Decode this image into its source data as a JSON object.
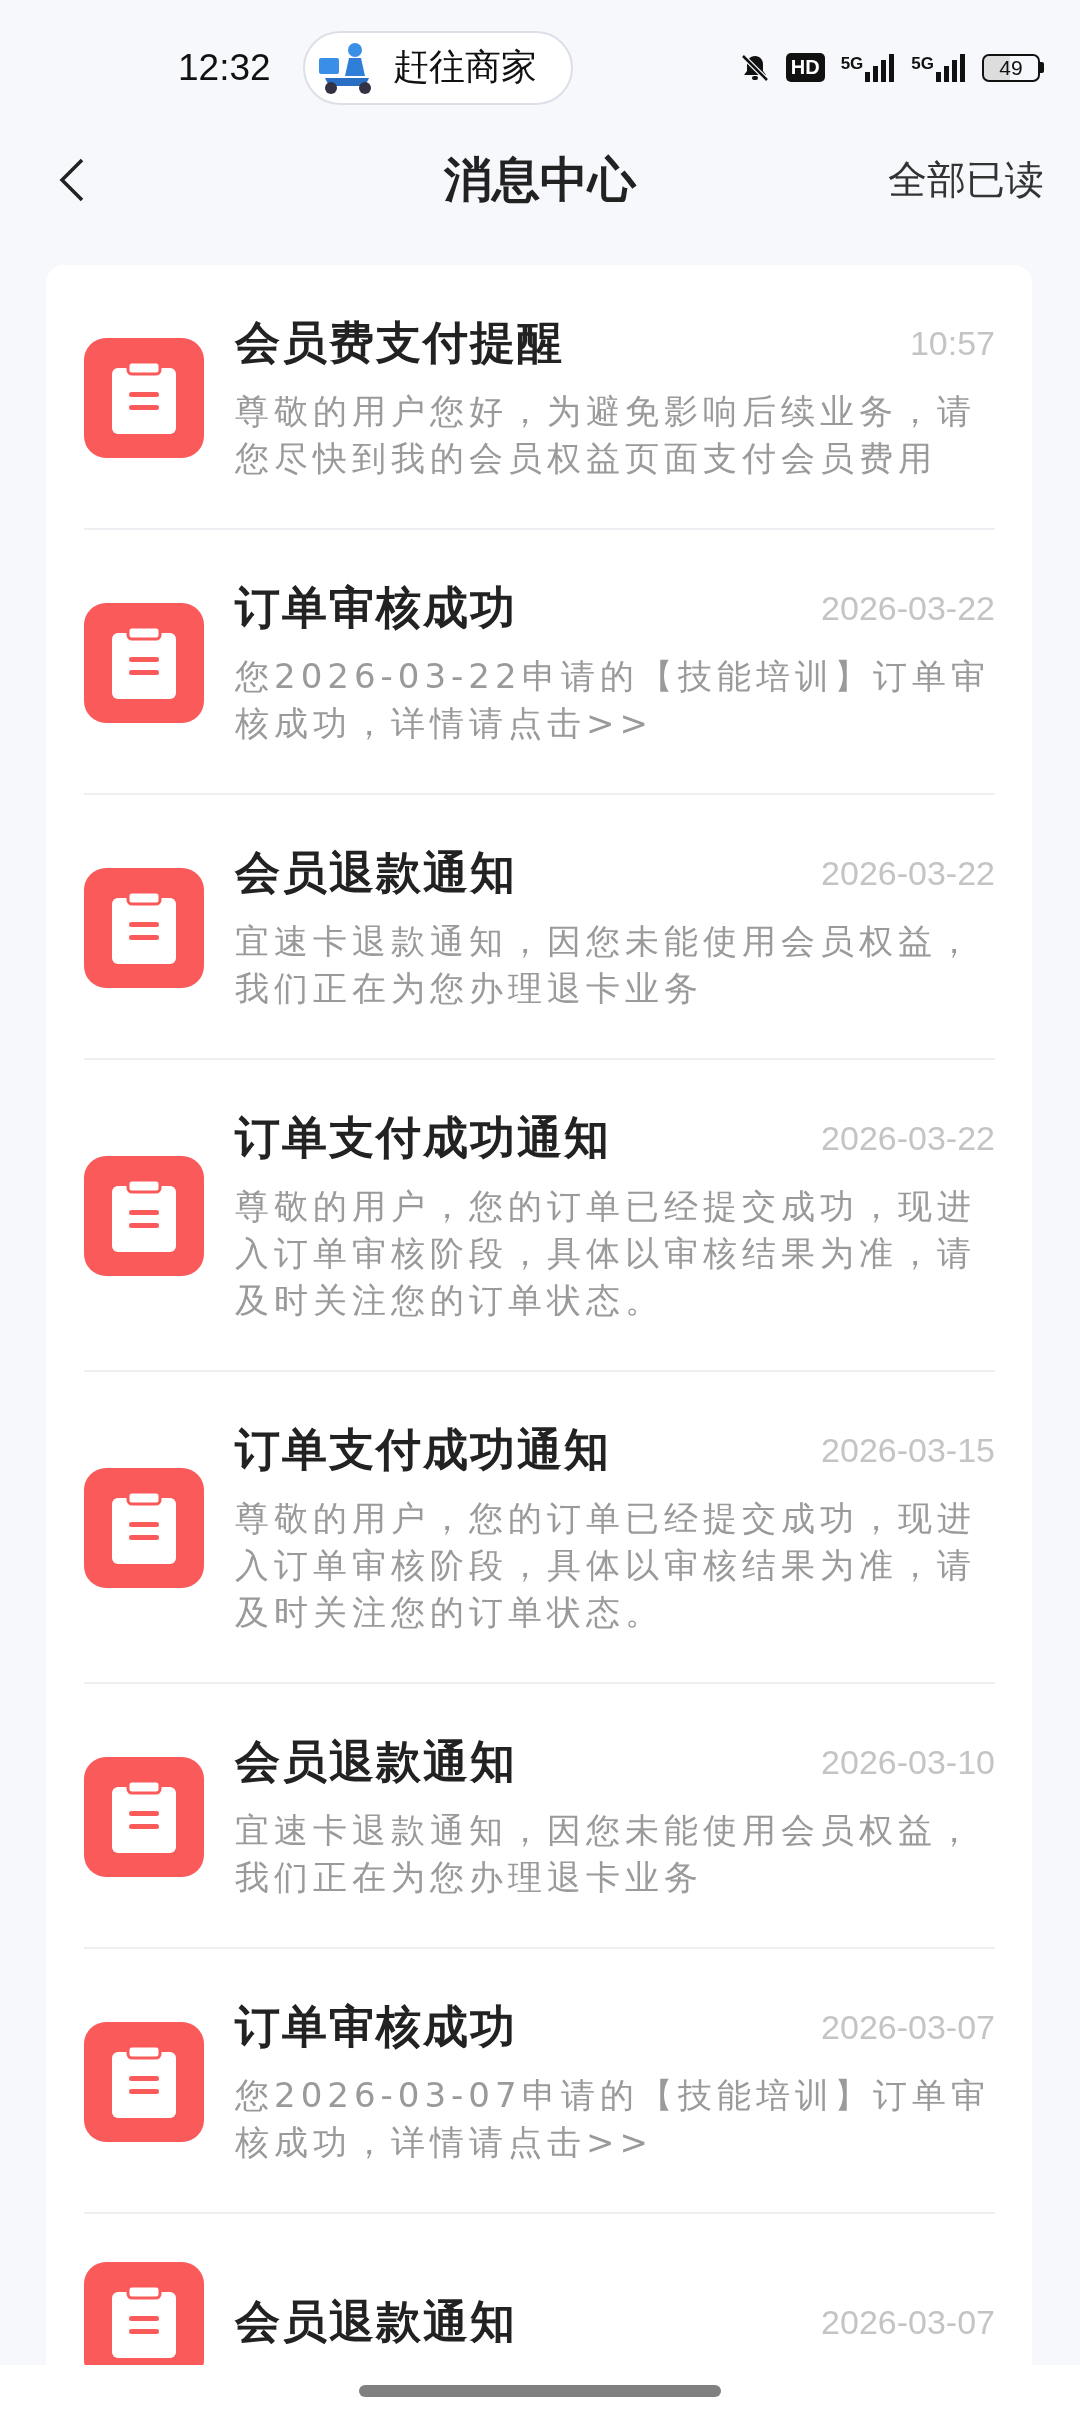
{
  "status_bar": {
    "time": "12:32",
    "activity": {
      "label": "赶往商家"
    },
    "muted": true,
    "hd_badge": "HD",
    "signals": [
      {
        "label": "5G"
      },
      {
        "label": "5G"
      }
    ],
    "battery": "49"
  },
  "header": {
    "title": "消息中心",
    "action": "全部已读"
  },
  "messages": [
    {
      "title": "会员费支付提醒",
      "time": "10:57",
      "text": "尊敬的用户您好，为避免影响后续业务，请您尽快到我的会员权益页面支付会员费用"
    },
    {
      "title": "订单审核成功",
      "time": "2026-03-22",
      "text": "您2026-03-22申请的【技能培训】订单审核成功，详情请点击>>"
    },
    {
      "title": "会员退款通知",
      "time": "2026-03-22",
      "text": "宜速卡退款通知，因您未能使用会员权益，我们正在为您办理退卡业务"
    },
    {
      "title": "订单支付成功通知",
      "time": "2026-03-22",
      "text": "尊敬的用户，您的订单已经提交成功，现进入订单审核阶段，具体以审核结果为准，请及时关注您的订单状态。"
    },
    {
      "title": "订单支付成功通知",
      "time": "2026-03-15",
      "text": "尊敬的用户，您的订单已经提交成功，现进入订单审核阶段，具体以审核结果为准，请及时关注您的订单状态。"
    },
    {
      "title": "会员退款通知",
      "time": "2026-03-10",
      "text": "宜速卡退款通知，因您未能使用会员权益，我们正在为您办理退卡业务"
    },
    {
      "title": "订单审核成功",
      "time": "2026-03-07",
      "text": "您2026-03-07申请的【技能培训】订单审核成功，详情请点击>>"
    },
    {
      "title": "会员退款通知",
      "time": "2026-03-07"
    }
  ]
}
